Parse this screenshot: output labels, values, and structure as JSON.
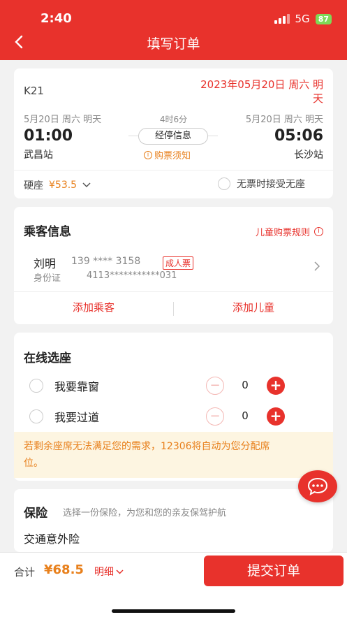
{
  "status": {
    "time": "2:40",
    "network": "5G",
    "battery": "87"
  },
  "header": {
    "title": "填写订单"
  },
  "trip": {
    "train": "K21",
    "date_line1": "2023年05月20日 周六 明",
    "date_line2": "天",
    "dep_date": "5月20日 周六 明天",
    "arr_date": "5月20日 周六 明天",
    "duration": "4时6分",
    "dep_time": "01:00",
    "arr_time": "05:06",
    "stops_button": "经停信息",
    "dep_station": "武昌站",
    "arr_station": "长沙站",
    "notice_link": "购票须知",
    "seat_type": "硬座",
    "price": "¥53.5",
    "no_seat_option": "无票时接受无座"
  },
  "passenger": {
    "section_title": "乘客信息",
    "child_rules": "儿童购票规则",
    "name": "刘明",
    "phone": "139 **** 3158",
    "ticket_badge": "成人票",
    "id_type": "身份证",
    "id_number": "4113***********031",
    "add_passenger": "添加乘客",
    "add_child": "添加儿童"
  },
  "seat": {
    "section_title": "在线选座",
    "window_label": "我要靠窗",
    "window_count": "0",
    "aisle_label": "我要过道",
    "aisle_count": "0",
    "notice_line1": "若剩余座席无法满足您的需求，12306将自动为您分配席",
    "notice_line2": "位。"
  },
  "insurance": {
    "section_title": "保险",
    "subtitle": "选择一份保险，为您和您的亲友保驾护航",
    "item": "交通意外险"
  },
  "footer": {
    "total_label": "合计",
    "total_price": "¥68.5",
    "detail": "明细",
    "submit": "提交订单"
  },
  "colors": {
    "brand": "#e8322c",
    "price": "#e8801c",
    "notice_bg": "#fdf5e1"
  }
}
